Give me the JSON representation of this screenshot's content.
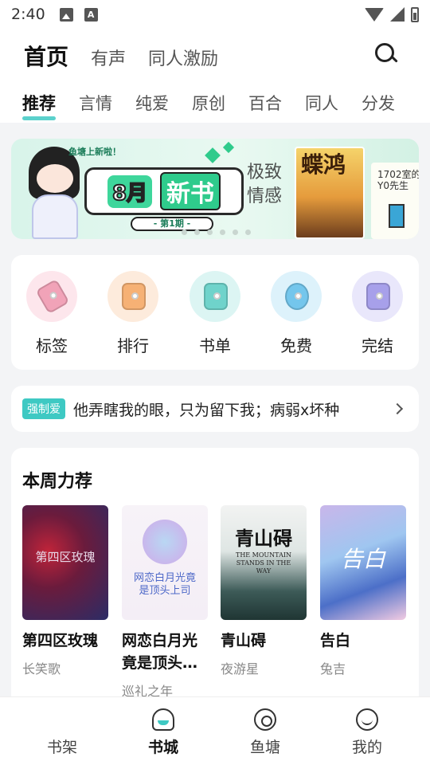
{
  "status_bar": {
    "time": "2:40"
  },
  "header": {
    "main_tabs": [
      {
        "label": "首页"
      },
      {
        "label": "有声"
      },
      {
        "label": "同人激励"
      }
    ],
    "sub_tabs": [
      {
        "label": "推荐"
      },
      {
        "label": "言情"
      },
      {
        "label": "纯爱"
      },
      {
        "label": "原创"
      },
      {
        "label": "百合"
      },
      {
        "label": "同人"
      },
      {
        "label": "分发"
      }
    ]
  },
  "banner": {
    "speech": "鱼塘上新啦！",
    "month": "8月",
    "new": "新书",
    "issue": "- 第1期 -",
    "calligraphy": "极致情感",
    "cover1_title": "蝶鸿",
    "cover2_title": "1702室的Y0先生"
  },
  "categories": [
    {
      "label": "标签",
      "icon": "tag-icon",
      "color": "#fde6ec",
      "glyph": "#f1a3b8"
    },
    {
      "label": "排行",
      "icon": "ranking-icon",
      "color": "#fdebdc",
      "glyph": "#f6b175"
    },
    {
      "label": "书单",
      "icon": "booklist-icon",
      "color": "#dcf5f3",
      "glyph": "#6fd3cb"
    },
    {
      "label": "免费",
      "icon": "unlock-icon",
      "color": "#ddf2fb",
      "glyph": "#74c6ec"
    },
    {
      "label": "完结",
      "icon": "completed-icon",
      "color": "#e9e7fb",
      "glyph": "#a7a0ea"
    }
  ],
  "notice": {
    "tag": "强制爱",
    "text": "他弄瞎我的眼，只为留下我；病弱x坏种"
  },
  "weekly": {
    "title": "本周力荐",
    "books": [
      {
        "name": "第四区玫瑰",
        "author": "长笑歌",
        "cover_text": "第四区玫瑰"
      },
      {
        "name": "网恋白月光竟是顶头…",
        "author": "巡礼之年",
        "cover_text": "网恋白月光竟是顶头上司"
      },
      {
        "name": "青山碍",
        "author": "夜游星",
        "cover_text": "青山碍",
        "cover_sub": "THE MOUNTAIN STANDS IN THE WAY"
      },
      {
        "name": "告白",
        "author": "兔吉",
        "cover_text": "告白"
      }
    ]
  },
  "bottom_nav": [
    {
      "label": "书架",
      "icon": "bookshelf-icon"
    },
    {
      "label": "书城",
      "icon": "bookstore-icon"
    },
    {
      "label": "鱼塘",
      "icon": "fishpond-icon"
    },
    {
      "label": "我的",
      "icon": "profile-icon"
    }
  ]
}
